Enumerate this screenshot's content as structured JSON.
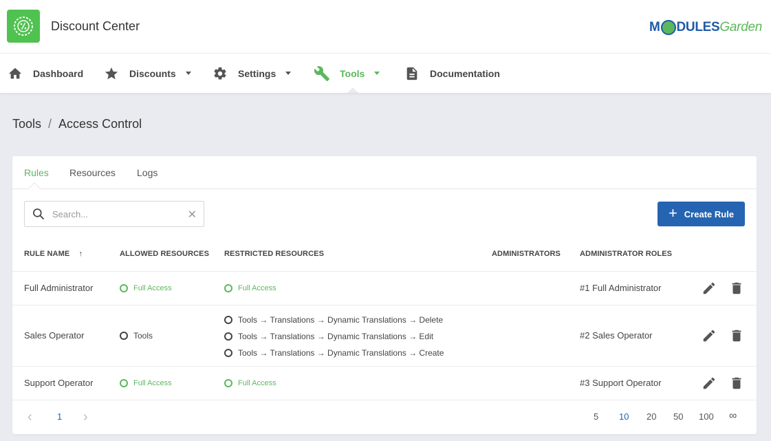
{
  "header": {
    "app_title": "Discount Center",
    "brand_left": "M",
    "brand_mid": "DULES",
    "brand_right": "Garden"
  },
  "nav": {
    "items": [
      {
        "label": "Dashboard",
        "icon": "home-icon"
      },
      {
        "label": "Discounts",
        "icon": "star-icon"
      },
      {
        "label": "Settings",
        "icon": "gear-icon"
      },
      {
        "label": "Tools",
        "icon": "wrench-icon",
        "active": true
      },
      {
        "label": "Documentation",
        "icon": "document-icon"
      }
    ]
  },
  "breadcrumb": {
    "parent": "Tools",
    "separator": "/",
    "current": "Access Control"
  },
  "tabs": [
    {
      "label": "Rules",
      "active": true
    },
    {
      "label": "Resources"
    },
    {
      "label": "Logs"
    }
  ],
  "search": {
    "placeholder": "Search...",
    "clear": "✕"
  },
  "create_button": {
    "label": "Create Rule",
    "plus": "+"
  },
  "table": {
    "headers": {
      "rule_name": "RULE NAME",
      "sort_arrow": "↑",
      "allowed": "ALLOWED RESOURCES",
      "restricted": "RESTRICTED RESOURCES",
      "administrators": "ADMINISTRATORS",
      "roles": "ADMINISTRATOR ROLES"
    },
    "rows": [
      {
        "name": "Full Administrator",
        "allowed": "Full Access",
        "restricted": [
          "Full Access"
        ],
        "role": "#1 Full Administrator"
      },
      {
        "name": "Sales Operator",
        "allowed": "Tools",
        "restricted": [
          "Tools → Translations → Dynamic Translations → Delete",
          "Tools → Translations → Dynamic Translations → Edit",
          "Tools → Translations → Dynamic Translations → Create"
        ],
        "role": "#2 Sales Operator"
      },
      {
        "name": "Support Operator",
        "allowed": "Full Access",
        "restricted": [
          "Full Access"
        ],
        "role": "#3 Support Operator"
      }
    ]
  },
  "pagination": {
    "prev": "‹",
    "current_page": "1",
    "next": "›",
    "page_sizes": [
      "5",
      "10",
      "20",
      "50",
      "100",
      "∞"
    ],
    "selected_size": "10"
  },
  "colors": {
    "accent_green": "#5cb85c",
    "primary_blue": "#2564b0"
  }
}
